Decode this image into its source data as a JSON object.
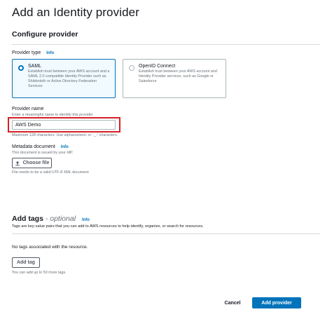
{
  "page": {
    "title": "Add an Identity provider"
  },
  "configure": {
    "section_title": "Configure provider",
    "provider_type_label": "Provider type",
    "info_label": "Info",
    "options": [
      {
        "title": "SAML",
        "description": "Establish trust between your AWS account and a SAML 2.0 compatible Identity Provider such as Shibboleth or Active Directory Federation Services",
        "selected": true
      },
      {
        "title": "OpenID Connect",
        "description": "Establish trust between your AWS account and Identity Provider services, such as Google or Salesforce",
        "selected": false
      }
    ]
  },
  "provider_name": {
    "label": "Provider name",
    "hint": "Enter a meaningful name to identify this provider",
    "value": "AWS Demo",
    "constraint": "Maximum 128 characters. Use alphanumeric or '._-' characters."
  },
  "metadata": {
    "label": "Metadata document",
    "info_label": "Info",
    "hint": "This document is issued by your IdP.",
    "button_label": "Choose file",
    "file_hint": "File needs to be a valid UTF-8 XML document"
  },
  "tags": {
    "title": "Add tags",
    "optional": "- optional",
    "info_label": "Info",
    "description": "Tags are key-value pairs that you can add to AWS resources to help identify, organize, or search for resources.",
    "empty_text": "No tags associated with the resource.",
    "add_button_label": "Add tag",
    "limit_text": "You can add up to 50 more tags."
  },
  "footer": {
    "cancel_label": "Cancel",
    "submit_label": "Add provider"
  },
  "colors": {
    "accent": "#0073bb",
    "highlight": "#d61f26",
    "selected_bg": "#f1faff"
  }
}
